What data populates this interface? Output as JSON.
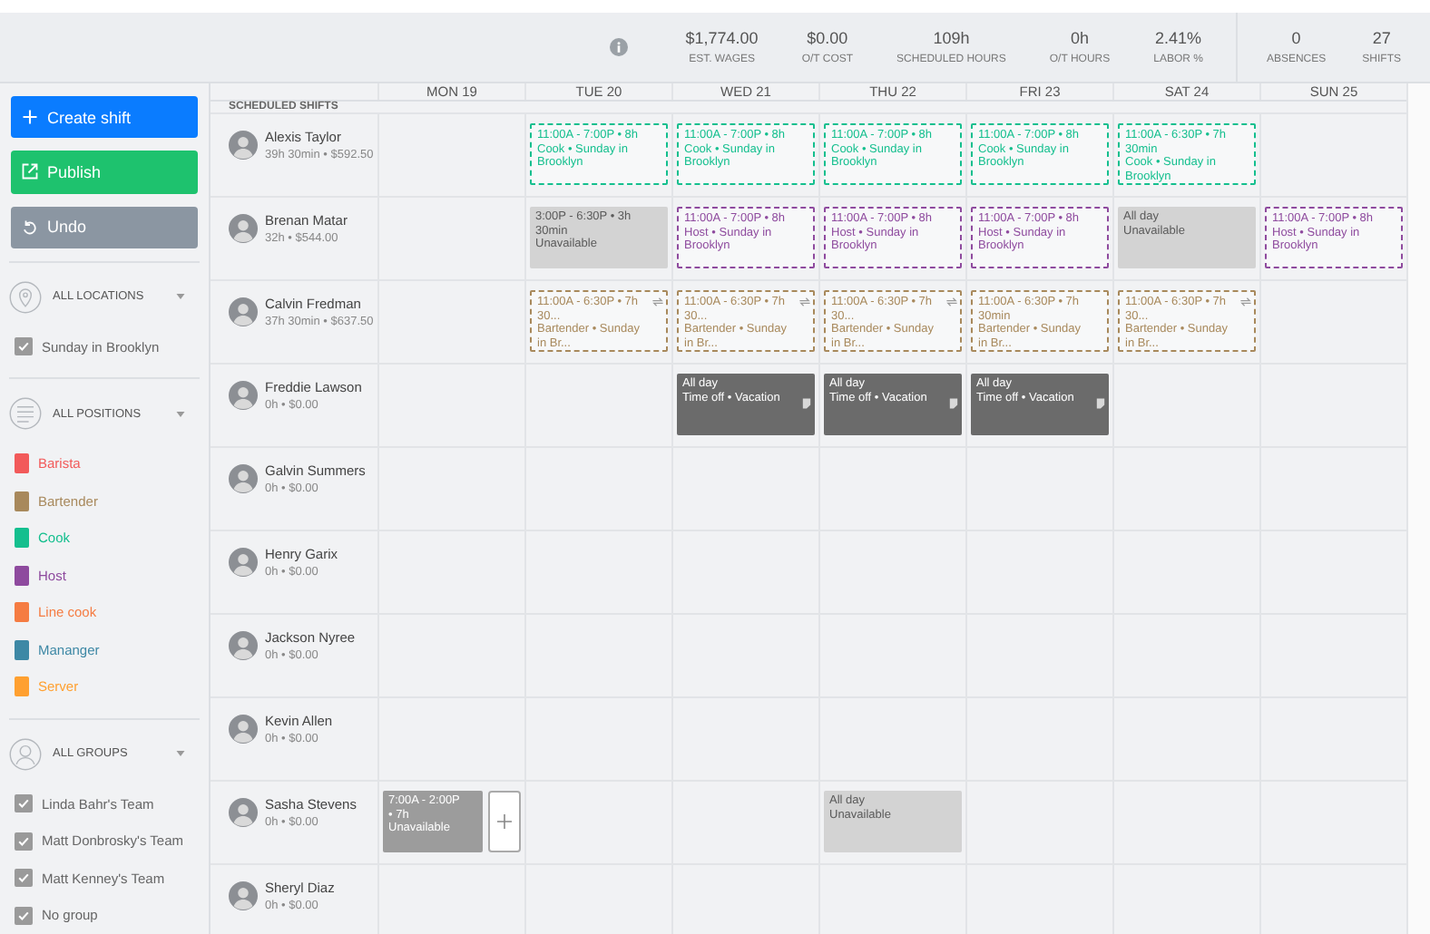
{
  "stats": [
    {
      "value": "$1,774.00",
      "label": "EST. WAGES"
    },
    {
      "value": "$0.00",
      "label": "O/T COST"
    },
    {
      "value": "109h",
      "label": "SCHEDULED HOURS"
    },
    {
      "value": "0h",
      "label": "O/T HOURS"
    },
    {
      "value": "2.41%",
      "label": "LABOR %"
    }
  ],
  "counts": [
    {
      "value": "0",
      "label": "ABSENCES"
    },
    {
      "value": "27",
      "label": "SHIFTS"
    }
  ],
  "actions": [
    {
      "label": "Create shift",
      "kind": "create"
    },
    {
      "label": "Publish",
      "kind": "publish"
    },
    {
      "label": "Undo",
      "kind": "undo"
    }
  ],
  "locations": {
    "title": "ALL LOCATIONS",
    "items": [
      {
        "label": "Sunday in Brooklyn",
        "checked": true
      }
    ]
  },
  "positions": {
    "title": "ALL POSITIONS",
    "items": [
      {
        "label": "Barista",
        "color": "#f25a5a"
      },
      {
        "label": "Bartender",
        "color": "#a8895c"
      },
      {
        "label": "Cook",
        "color": "#14bf8e"
      },
      {
        "label": "Host",
        "color": "#8e4a9e"
      },
      {
        "label": "Line cook",
        "color": "#f57c42"
      },
      {
        "label": "Mananger",
        "color": "#3d88a5"
      },
      {
        "label": "Server",
        "color": "#ffa030"
      }
    ]
  },
  "groups": {
    "title": "ALL GROUPS",
    "items": [
      {
        "label": "Linda Bahr's Team",
        "checked": true
      },
      {
        "label": "Matt Donbrosky's Team",
        "checked": true
      },
      {
        "label": "Matt Kenney's Team",
        "checked": true
      },
      {
        "label": "No group",
        "checked": true
      }
    ]
  },
  "days": [
    "MON 19",
    "TUE 20",
    "WED 21",
    "THU 22",
    "FRI 23",
    "SAT 24",
    "SUN 25"
  ],
  "section_label": "SCHEDULED SHIFTS",
  "employees": [
    {
      "name": "Alexis Taylor",
      "meta": "39h 30min • $592.50",
      "cells": [
        null,
        {
          "kind": "shift",
          "time": "11:00A - 7:00P • 8h",
          "detail": "Cook • Sunday in Brooklyn",
          "color": "#14bf8e"
        },
        {
          "kind": "shift",
          "time": "11:00A - 7:00P • 8h",
          "detail": "Cook • Sunday in Brooklyn",
          "color": "#14bf8e"
        },
        {
          "kind": "shift",
          "time": "11:00A - 7:00P • 8h",
          "detail": "Cook • Sunday in Brooklyn",
          "color": "#14bf8e"
        },
        {
          "kind": "shift",
          "time": "11:00A - 7:00P • 8h",
          "detail": "Cook • Sunday in Brooklyn",
          "color": "#14bf8e"
        },
        {
          "kind": "shift",
          "time": "11:00A - 6:30P • 7h 30min",
          "detail": "Cook • Sunday in Brooklyn",
          "color": "#14bf8e"
        },
        null
      ]
    },
    {
      "name": "Brenan Matar",
      "meta": "32h • $544.00",
      "cells": [
        null,
        {
          "kind": "unavailable",
          "time": "3:00P - 6:30P • 3h 30min",
          "detail": "Unavailable"
        },
        {
          "kind": "shift",
          "time": "11:00A - 7:00P • 8h",
          "detail": "Host • Sunday in Brooklyn",
          "color": "#8e4a9e"
        },
        {
          "kind": "shift",
          "time": "11:00A - 7:00P • 8h",
          "detail": "Host • Sunday in Brooklyn",
          "color": "#8e4a9e"
        },
        {
          "kind": "shift",
          "time": "11:00A - 7:00P • 8h",
          "detail": "Host • Sunday in Brooklyn",
          "color": "#8e4a9e"
        },
        {
          "kind": "unavailable",
          "time": "All day",
          "detail": "Unavailable"
        },
        {
          "kind": "shift",
          "time": "11:00A - 7:00P • 8h",
          "detail": "Host • Sunday in Brooklyn",
          "color": "#8e4a9e"
        }
      ]
    },
    {
      "name": "Calvin Fredman",
      "meta": "37h 30min • $637.50",
      "cells": [
        null,
        {
          "kind": "shift",
          "time": "11:00A - 6:30P • 7h 30...",
          "detail": "Bartender • Sunday in Br...",
          "color": "#a8895c",
          "repeat": true
        },
        {
          "kind": "shift",
          "time": "11:00A - 6:30P • 7h 30...",
          "detail": "Bartender • Sunday in Br...",
          "color": "#a8895c",
          "repeat": true
        },
        {
          "kind": "shift",
          "time": "11:00A - 6:30P • 7h 30...",
          "detail": "Bartender • Sunday in Br...",
          "color": "#a8895c",
          "repeat": true
        },
        {
          "kind": "shift",
          "time": "11:00A - 6:30P • 7h 30min",
          "detail": "Bartender • Sunday in Br...",
          "color": "#a8895c",
          "repeat": false
        },
        {
          "kind": "shift",
          "time": "11:00A - 6:30P • 7h 30...",
          "detail": "Bartender • Sunday in Br...",
          "color": "#a8895c",
          "repeat": true
        },
        null
      ]
    },
    {
      "name": "Freddie Lawson",
      "meta": "0h • $0.00",
      "cells": [
        null,
        null,
        {
          "kind": "timeoff",
          "time": "All day",
          "detail": "Time off • Vacation",
          "note": true
        },
        {
          "kind": "timeoff",
          "time": "All day",
          "detail": "Time off • Vacation",
          "note": true
        },
        {
          "kind": "timeoff",
          "time": "All day",
          "detail": "Time off • Vacation",
          "note": true
        },
        null,
        null
      ]
    },
    {
      "name": "Galvin Summers",
      "meta": "0h • $0.00",
      "cells": [
        null,
        null,
        null,
        null,
        null,
        null,
        null
      ]
    },
    {
      "name": "Henry Garix",
      "meta": "0h • $0.00",
      "cells": [
        null,
        null,
        null,
        null,
        null,
        null,
        null
      ]
    },
    {
      "name": "Jackson Nyree",
      "meta": "0h • $0.00",
      "cells": [
        null,
        null,
        null,
        null,
        null,
        null,
        null
      ]
    },
    {
      "name": "Kevin Allen",
      "meta": "0h • $0.00",
      "cells": [
        null,
        null,
        null,
        null,
        null,
        null,
        null
      ]
    },
    {
      "name": "Sasha Stevens",
      "meta": "0h • $0.00",
      "cells": [
        {
          "kind": "unavailable",
          "time": "7:00A - 2:00P • 7h",
          "detail": "Unavailable",
          "hovered": true
        },
        null,
        null,
        {
          "kind": "unavailable",
          "time": "All day",
          "detail": "Unavailable"
        },
        null,
        null,
        null
      ]
    },
    {
      "name": "Sheryl Diaz",
      "meta": "0h • $0.00",
      "cells": [
        null,
        null,
        null,
        null,
        null,
        null,
        null
      ]
    }
  ]
}
